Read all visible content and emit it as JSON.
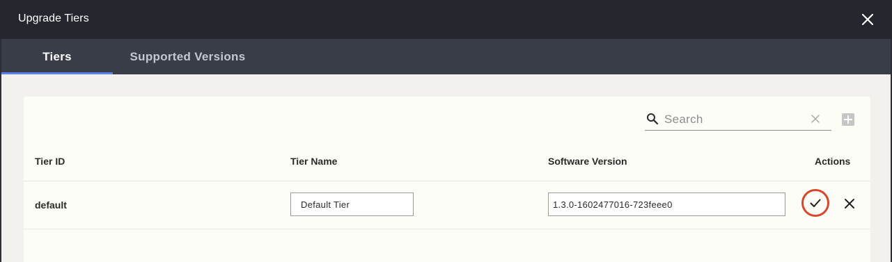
{
  "dialog": {
    "title": "Upgrade Tiers"
  },
  "tabs": [
    {
      "label": "Tiers",
      "active": true
    },
    {
      "label": "Supported Versions",
      "active": false
    }
  ],
  "search": {
    "placeholder": "Search",
    "value": ""
  },
  "table": {
    "columns": [
      "Tier ID",
      "Tier Name",
      "Software Version",
      "Actions"
    ],
    "rows": [
      {
        "tier_id": "default",
        "tier_name": "Default Tier",
        "software_version": "1.3.0-1602477016-723feee0"
      }
    ]
  },
  "icons": {
    "close": "close-icon",
    "search": "search-icon",
    "clear": "clear-icon",
    "add": "plus-icon",
    "confirm": "checkmark-icon",
    "cancel": "x-icon"
  },
  "colors": {
    "titlebar": "#23262d",
    "tabbar": "#393d47",
    "tab_active_indicator": "#5b7fee",
    "confirm_highlight": "#d9462b",
    "card": "#fdfdf8",
    "backdrop": "#f2f1ee"
  }
}
